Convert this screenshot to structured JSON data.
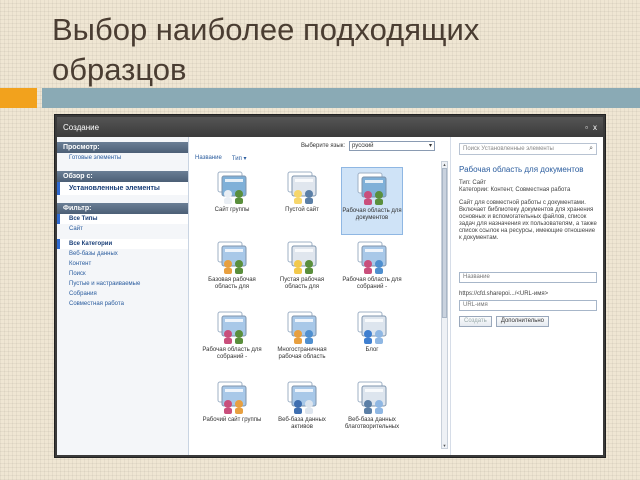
{
  "slide": {
    "title": "Выбор наиболее подходящих образцов"
  },
  "window": {
    "title": "Создание",
    "minimize": "▫",
    "close": "x"
  },
  "left": {
    "browse": {
      "header": "Просмотр:",
      "items": [
        "Готовые элементы"
      ]
    },
    "filter_by": {
      "header": "Обзор с:",
      "items": [
        "Установленные элементы"
      ]
    },
    "filter": {
      "header": "Фильтр:",
      "types": [
        "Все Типы",
        "Сайт"
      ],
      "categories": [
        "Все Категории",
        "Веб-базы данных",
        "Контент",
        "Поиск",
        "Пустые и настраиваемые",
        "Собрания",
        "Совместная работа"
      ]
    }
  },
  "middle": {
    "lang_label": "Выберите язык:",
    "lang_value": "русский",
    "sort": [
      "Название",
      "Тип ▾"
    ],
    "tiles": [
      {
        "label": "Сайт группы",
        "icon": "team-site-icon"
      },
      {
        "label": "Пустой сайт",
        "icon": "blank-site-icon"
      },
      {
        "label": "Рабочая область для документов",
        "icon": "document-workspace-icon"
      },
      {
        "label": "Базовая рабочая область для",
        "icon": "basic-meeting-workspace-icon"
      },
      {
        "label": "Пустая рабочая область для",
        "icon": "blank-meeting-workspace-icon"
      },
      {
        "label": "Рабочая область для собраний -",
        "icon": "decision-meeting-workspace-icon"
      },
      {
        "label": "Рабочая область для собраний -",
        "icon": "social-meeting-workspace-icon"
      },
      {
        "label": "Многостраничная рабочая область",
        "icon": "multipage-meeting-workspace-icon"
      },
      {
        "label": "Блог",
        "icon": "blog-icon"
      },
      {
        "label": "Рабочий сайт группы",
        "icon": "group-work-site-icon"
      },
      {
        "label": "Веб-база данных активов",
        "icon": "assets-web-database-icon"
      },
      {
        "label": "Веб-база данных благотворительных",
        "icon": "charitable-web-database-icon"
      }
    ]
  },
  "right": {
    "search_placeholder": "Поиск Установленные элементы",
    "title": "Рабочая область для документов",
    "type": "Тип: Сайт",
    "categories": "Категории: Контент, Совместная работа",
    "description": "Сайт для совместной работы с документами. Включает библиотеку документов для хранения основных и вспомогательных файлов, список задач для назначения их пользователям, а также список ссылок на ресурсы, имеющие отношение к документам.",
    "name_placeholder": "Название",
    "url_prefix": "https://cfd.sharepoi.../<URL-имя>",
    "url_placeholder": "URL-имя",
    "create_button": "Создать",
    "more_button": "Дополнительно"
  },
  "colors": {
    "accent_orange": "#f2a21d",
    "accent_blue": "#8aaab5",
    "link_blue": "#2a5c9e",
    "section_header": "#4c5f76"
  }
}
